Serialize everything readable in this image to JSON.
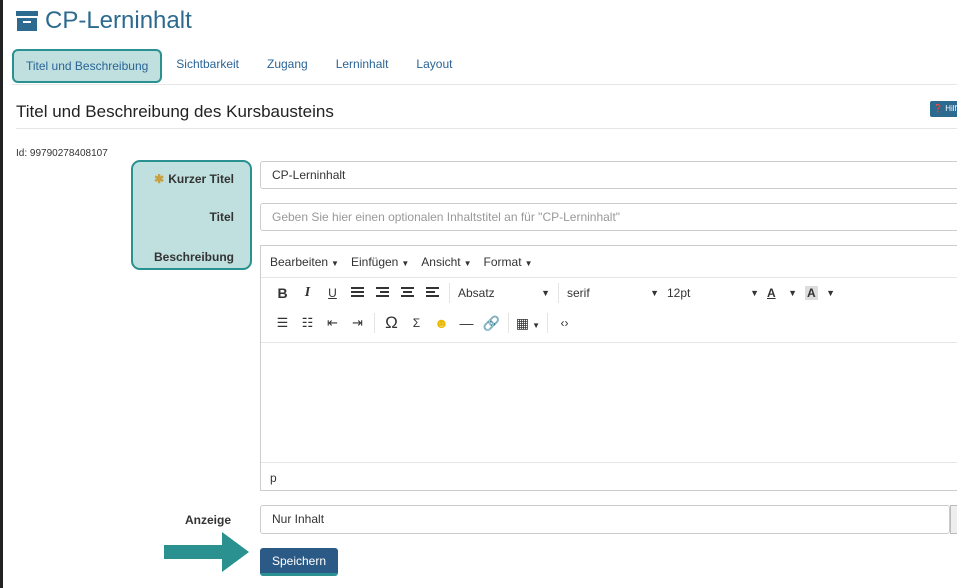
{
  "header": {
    "title": "CP-Lerninhalt",
    "icon": "archive-box-icon"
  },
  "tabs": [
    {
      "label": "Titel und Beschreibung",
      "active": true
    },
    {
      "label": "Sichtbarkeit",
      "active": false
    },
    {
      "label": "Zugang",
      "active": false
    },
    {
      "label": "Lerninhalt",
      "active": false
    },
    {
      "label": "Layout",
      "active": false
    }
  ],
  "section": {
    "title": "Titel und Beschreibung des Kursbausteins",
    "help_label": "Hilfe"
  },
  "node_id": "Id: 99790278408107",
  "form": {
    "short_title_label": "Kurzer Titel",
    "required_star": "✱",
    "short_title_value": "CP-Lerninhalt",
    "title_label": "Titel",
    "title_placeholder": "Geben Sie hier einen optionalen Inhaltstitel an für \"CP-Lerninhalt\"",
    "description_label": "Beschreibung",
    "display_label": "Anzeige",
    "display_value": "Nur Inhalt",
    "save_label": "Speichern"
  },
  "editor": {
    "menus": [
      "Bearbeiten",
      "Einfügen",
      "Ansicht",
      "Format"
    ],
    "bold": "B",
    "italic": "I",
    "underline": "U",
    "block_format": "Absatz",
    "font_family": "serif",
    "font_size": "12pt",
    "text_color_glyph": "A",
    "bg_color_glyph": "A",
    "omega": "Ω",
    "sigma": "Σ",
    "hr": "—",
    "code": "‹›",
    "status_path": "p"
  },
  "colors": {
    "accent": "#2c6a8f",
    "highlight_fill": "#bfe0df",
    "highlight_border": "#2a9090",
    "save_button": "#2c5a86"
  }
}
